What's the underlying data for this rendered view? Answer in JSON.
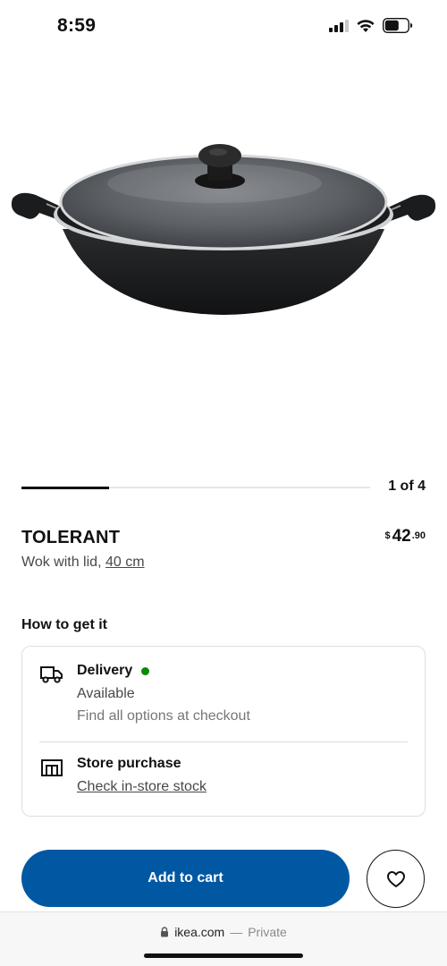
{
  "status_bar": {
    "time": "8:59"
  },
  "carousel": {
    "counter": "1 of 4",
    "progress_fraction": 0.25
  },
  "product": {
    "name": "TOLERANT",
    "description": "Wok with lid, ",
    "size": "40 cm",
    "price": {
      "currency": "$",
      "main": "42",
      "cents": ".90"
    }
  },
  "availability": {
    "section_title": "How to get it",
    "delivery": {
      "title": "Delivery",
      "status": "Available",
      "note": "Find all options at checkout",
      "status_color": "#0a8a00"
    },
    "store": {
      "title": "Store purchase",
      "link": "Check in-store stock"
    }
  },
  "actions": {
    "add_to_cart": "Add to cart",
    "accent_color": "#0058a3"
  },
  "browser": {
    "domain": "ikea.com",
    "separator": "—",
    "mode": "Private"
  }
}
